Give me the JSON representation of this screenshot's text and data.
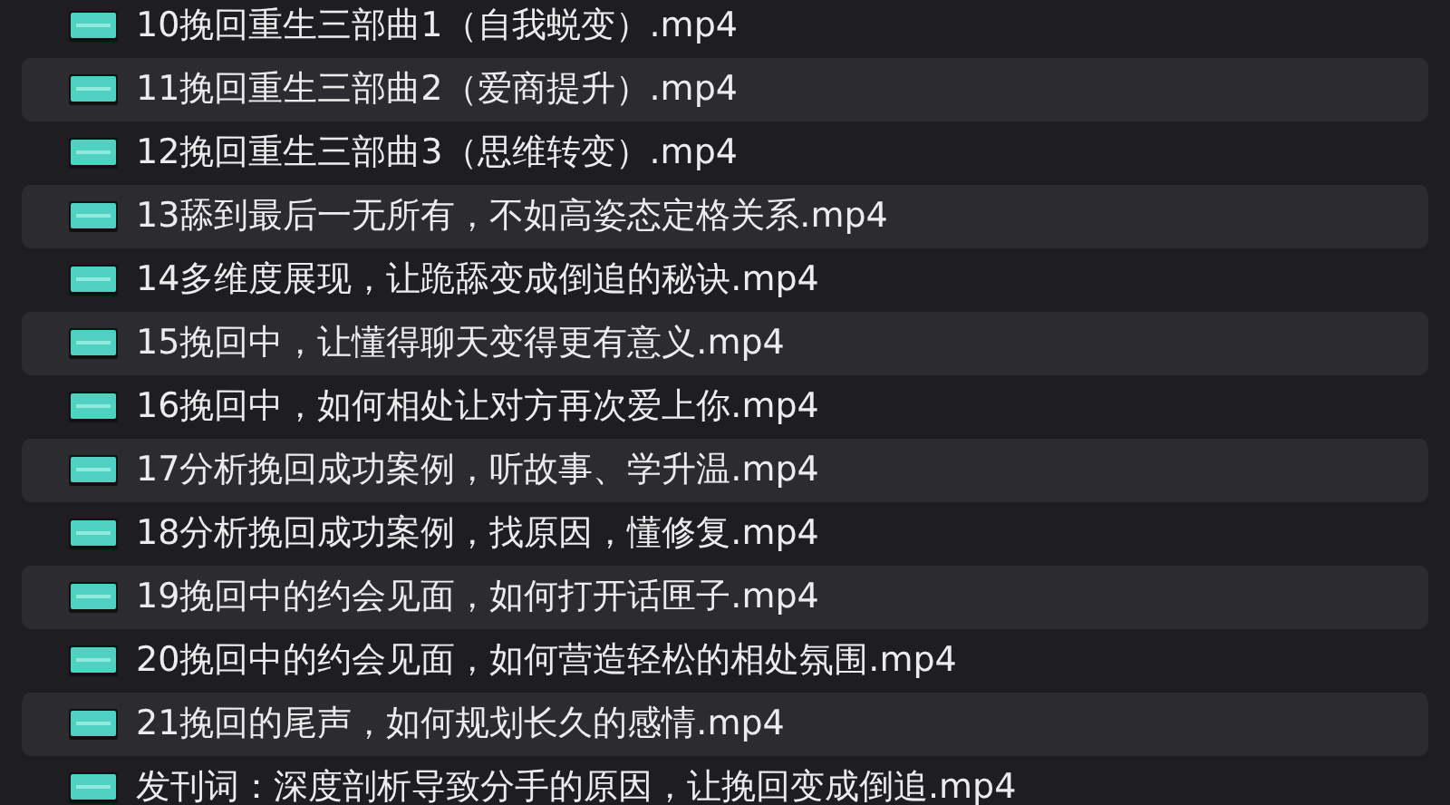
{
  "files": [
    {
      "name": "10挽回重生三部曲1（自我蜕变）.mp4"
    },
    {
      "name": "11挽回重生三部曲2（爱商提升）.mp4"
    },
    {
      "name": "12挽回重生三部曲3（思维转变）.mp4"
    },
    {
      "name": "13舔到最后一无所有，不如高姿态定格关系.mp4"
    },
    {
      "name": "14多维度展现，让跪舔变成倒追的秘诀.mp4"
    },
    {
      "name": "15挽回中，让懂得聊天变得更有意义.mp4"
    },
    {
      "name": "16挽回中，如何相处让对方再次爱上你.mp4"
    },
    {
      "name": "17分析挽回成功案例，听故事、学升温.mp4"
    },
    {
      "name": "18分析挽回成功案例，找原因，懂修复.mp4"
    },
    {
      "name": "19挽回中的约会见面，如何打开话匣子.mp4"
    },
    {
      "name": "20挽回中的约会见面，如何营造轻松的相处氛围.mp4"
    },
    {
      "name": "21挽回的尾声，如何规划长久的感情.mp4"
    },
    {
      "name": "发刊词：深度剖析导致分手的原因，让挽回变成倒追.mp4"
    }
  ]
}
